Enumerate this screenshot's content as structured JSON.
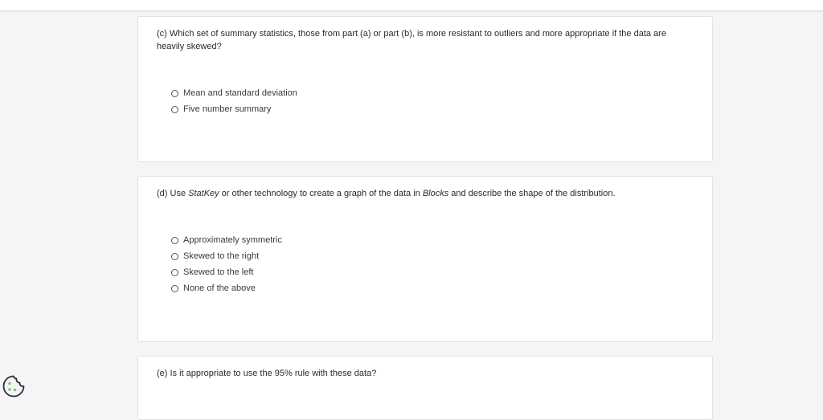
{
  "questions": {
    "c": {
      "prefix": "(c) Which set of summary statistics, those from part (a) or part (b), is more resistant to outliers and more appropriate if the data are heavily skewed?",
      "options": [
        "Mean and standard deviation",
        "Five number summary"
      ]
    },
    "d": {
      "text_before": "(d) Use ",
      "italic_1": "StatKey",
      "text_middle": " or other technology to create a graph of the data in ",
      "italic_2": "Blocks",
      "text_after": " and describe the shape of the distribution.",
      "options": [
        "Approximately symmetric",
        "Skewed to the right",
        "Skewed to the left",
        "None of the above"
      ]
    },
    "e": {
      "text": "(e) Is it appropriate to use the 95% rule with these data?"
    }
  },
  "icons": {
    "cookie": "cookie-settings-icon",
    "radio": "radio-unselected-icon"
  },
  "colors": {
    "background": "#f5f5f5",
    "card": "#ffffff",
    "border": "#e1e1e1",
    "text": "#2a2a2a"
  }
}
